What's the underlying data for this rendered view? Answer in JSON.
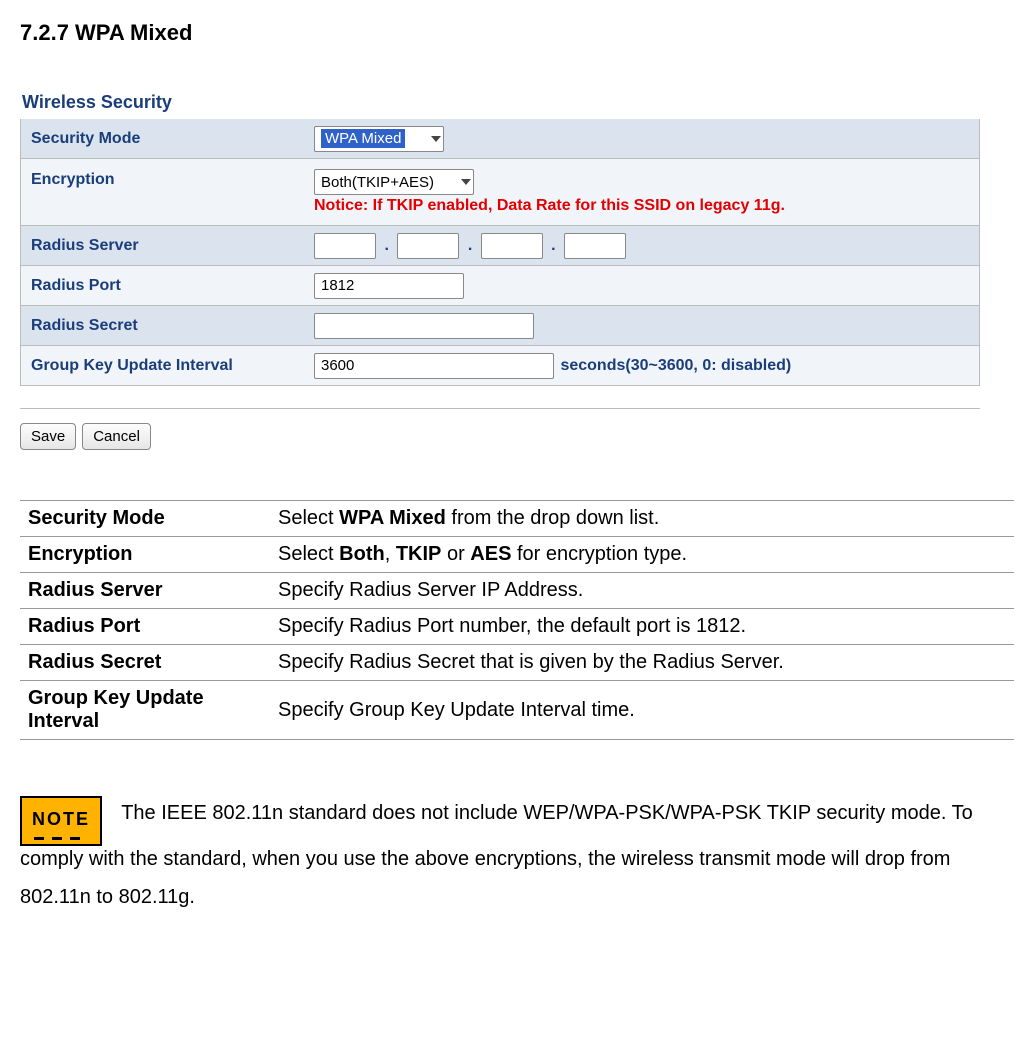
{
  "section_title": "7.2.7 WPA Mixed",
  "panel": {
    "heading": "Wireless Security",
    "rows": {
      "security_mode": {
        "label": "Security Mode",
        "value": "WPA Mixed"
      },
      "encryption": {
        "label": "Encryption",
        "value": "Both(TKIP+AES)",
        "notice": "Notice: If TKIP enabled, Data Rate for this SSID on legacy 11g."
      },
      "radius_server": {
        "label": "Radius Server",
        "ip": [
          "",
          "",
          "",
          ""
        ]
      },
      "radius_port": {
        "label": "Radius Port",
        "value": "1812"
      },
      "radius_secret": {
        "label": "Radius Secret",
        "value": ""
      },
      "gku": {
        "label": "Group Key Update Interval",
        "value": "3600",
        "suffix": "seconds(30~3600, 0: disabled)"
      }
    },
    "buttons": {
      "save": "Save",
      "cancel": "Cancel"
    }
  },
  "desc_table": [
    {
      "key": "Security Mode",
      "val_pre": "Select ",
      "b1": "WPA Mixed",
      "val_mid": " from the drop down list."
    },
    {
      "key": "Encryption",
      "val_pre": "Select ",
      "b1": "Both",
      "val_mid": ", ",
      "b2": "TKIP",
      "val_mid2": " or ",
      "b3": "AES",
      "val_post": " for encryption type."
    },
    {
      "key": "Radius Server",
      "val": "Specify Radius Server IP Address."
    },
    {
      "key": "Radius Port",
      "val": "Specify Radius Port number, the default port is 1812."
    },
    {
      "key": "Radius Secret",
      "val": "Specify Radius Secret that is given by the Radius Server."
    },
    {
      "key": "Group Key Update Interval",
      "val": "Specify Group Key Update Interval time."
    }
  ],
  "note": {
    "badge": "NOTE",
    "text1": " The IEEE 802.11n standard does not include WEP/WPA-PSK/WPA-PSK TKIP security mode. To comply with the standard, when you use the above encryptions, the wireless transmit mode will drop from 802.11n to 802.11g."
  }
}
